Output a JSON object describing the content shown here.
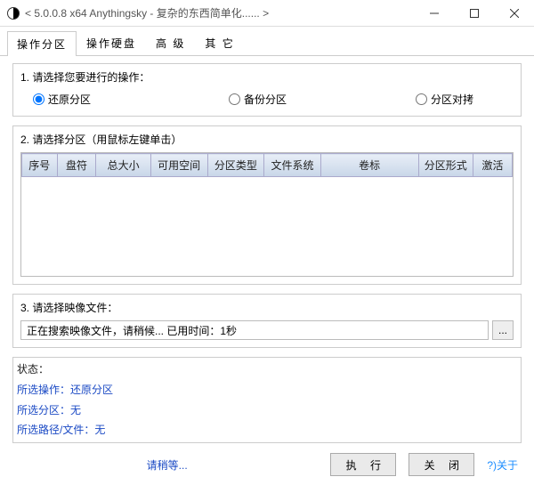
{
  "window": {
    "title": "< 5.0.0.8 x64 Anythingsky - 复杂的东西简单化...... >"
  },
  "tabs": {
    "t0": "操作分区",
    "t1": "操作硬盘",
    "t2": "高  级",
    "t3": "其  它"
  },
  "section1": {
    "label": "1. 请选择您要进行的操作：",
    "opt_restore": "还原分区",
    "opt_backup": "备份分区",
    "opt_clone": "分区对拷"
  },
  "section2": {
    "label": "2. 请选择分区（用鼠标左键单击）",
    "headers": {
      "h0": "序号",
      "h1": "盘符",
      "h2": "总大小",
      "h3": "可用空间",
      "h4": "分区类型",
      "h5": "文件系统",
      "h6": "卷标",
      "h7": "分区形式",
      "h8": "激活"
    }
  },
  "section3": {
    "label": "3. 请选择映像文件：",
    "value": "正在搜索映像文件，请稍候...  已用时间：1秒",
    "browse": "..."
  },
  "status": {
    "header": "状态：",
    "l1": "所选操作：还原分区",
    "l2": "所选分区：无",
    "l3": "所选路径/文件：无"
  },
  "footer": {
    "wait": "请稍等...",
    "exec": "执  行",
    "close": "关  闭",
    "about": "?)关于"
  }
}
